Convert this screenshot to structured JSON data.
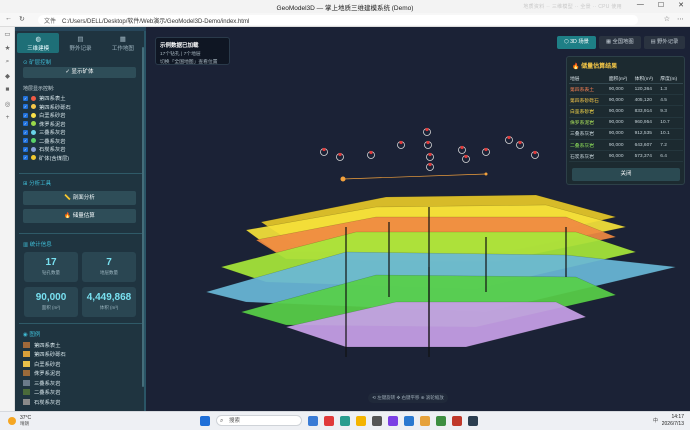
{
  "browser": {
    "title": "GeoModel3D — 掌上地质三维建模系统 (Demo)",
    "file_label": "文件",
    "url": "C:/Users/DELL/Desktop/软件/Web演示/GeoModel3D-Demo/index.html",
    "faint_overlay": "地质资料 ·· 三维模型 ·· 全景 ·· CPU 使用"
  },
  "sidebar": {
    "tabs": [
      {
        "label": "三维建模",
        "icon": "globe-icon"
      },
      {
        "label": "野外记录",
        "icon": "document-icon"
      },
      {
        "label": "工作地图",
        "icon": "map-icon"
      }
    ],
    "layer_control_title": "⊙ 矿层控制",
    "show_all_label": "✓ 显示矿体",
    "layer_display_title": "地层显示控制:",
    "layers": [
      {
        "label": "第四系表土",
        "color": "#f05a45"
      },
      {
        "label": "第四系砂砾石",
        "color": "#f6c84a"
      },
      {
        "label": "白垩系砂岩",
        "color": "#f9e14a"
      },
      {
        "label": "侏罗系泥岩",
        "color": "#9ad84a"
      },
      {
        "label": "三叠系灰岩",
        "color": "#6ad2e8"
      },
      {
        "label": "二叠系灰岩",
        "color": "#5ad26a"
      },
      {
        "label": "石炭系灰岩",
        "color": "#8aa0d8"
      },
      {
        "label": "矿体(含煤层)",
        "color": "#f0c830"
      }
    ],
    "analysis_title": "⊞ 分析工具",
    "analysis_buttons": [
      "剖面分析",
      "储量估算"
    ],
    "stats_title": "统计信息",
    "stats": [
      {
        "value": "17",
        "label": "钻孔数量"
      },
      {
        "value": "7",
        "label": "地层数量"
      },
      {
        "value": "90,000",
        "label": "面积 (m²)"
      },
      {
        "value": "4,449,868",
        "label": "体积 (m³)"
      }
    ],
    "legend_title": "图例",
    "legend": [
      {
        "label": "第四系表土",
        "color": "#a0693a"
      },
      {
        "label": "第四系砂砾石",
        "color": "#d8a03a"
      },
      {
        "label": "白垩系砂岩",
        "color": "#e8c04a"
      },
      {
        "label": "侏罗系泥岩",
        "color": "#9a6a3a"
      },
      {
        "label": "三叠系灰岩",
        "color": "#6a7a8a"
      },
      {
        "label": "二叠系灰岩",
        "color": "#4a6a3a"
      },
      {
        "label": "石炭系灰岩",
        "color": "#8a8a8a"
      }
    ]
  },
  "info_card": {
    "title": "示例数据已加载",
    "line1": "17个钻孔 | 7个地层",
    "line2": "切换「全国地图」查看位置"
  },
  "view_tabs": [
    {
      "label": "3D 场景",
      "icon": "cube-icon",
      "active": true
    },
    {
      "label": "全国地图",
      "icon": "map-icon",
      "active": false
    },
    {
      "label": "野外记录",
      "icon": "document-icon",
      "active": false
    }
  ],
  "reserve": {
    "title": "储量估算结果",
    "headers": [
      "地层",
      "面积(m²)",
      "体积(m³)",
      "厚度(m)"
    ],
    "rows": [
      {
        "name": "第四系表土",
        "area": "90,000",
        "volume": "120,364",
        "thickness": "1.3",
        "color": "#f57f52"
      },
      {
        "name": "第四系砂砾石",
        "area": "90,000",
        "volume": "405,120",
        "thickness": "4.5",
        "color": "#f6c84a"
      },
      {
        "name": "白垩系砂岩",
        "area": "90,000",
        "volume": "833,914",
        "thickness": "9.3",
        "color": "#f6d84a"
      },
      {
        "name": "侏罗系泥岩",
        "area": "90,000",
        "volume": "960,954",
        "thickness": "10.7",
        "color": "#a8e05a"
      },
      {
        "name": "三叠系灰岩",
        "area": "90,000",
        "volume": "912,535",
        "thickness": "10.1",
        "color": "#c5d2d8"
      },
      {
        "name": "二叠系灰岩",
        "area": "90,000",
        "volume": "643,607",
        "thickness": "7.2",
        "color": "#8ee05a"
      },
      {
        "name": "石炭系灰岩",
        "area": "90,000",
        "volume": "573,374",
        "thickness": "6.4",
        "color": "#c5d2d8"
      }
    ],
    "close_label": "关闭"
  },
  "hint": "⟲ 左键旋转  ✥ 右键平移  ⊕ 滚轮缩放",
  "taskbar": {
    "temp": "37°C",
    "weather": "晴朗",
    "search_placeholder": "搜索",
    "time": "14:17",
    "date": "2026/7/13",
    "lang": "中"
  }
}
